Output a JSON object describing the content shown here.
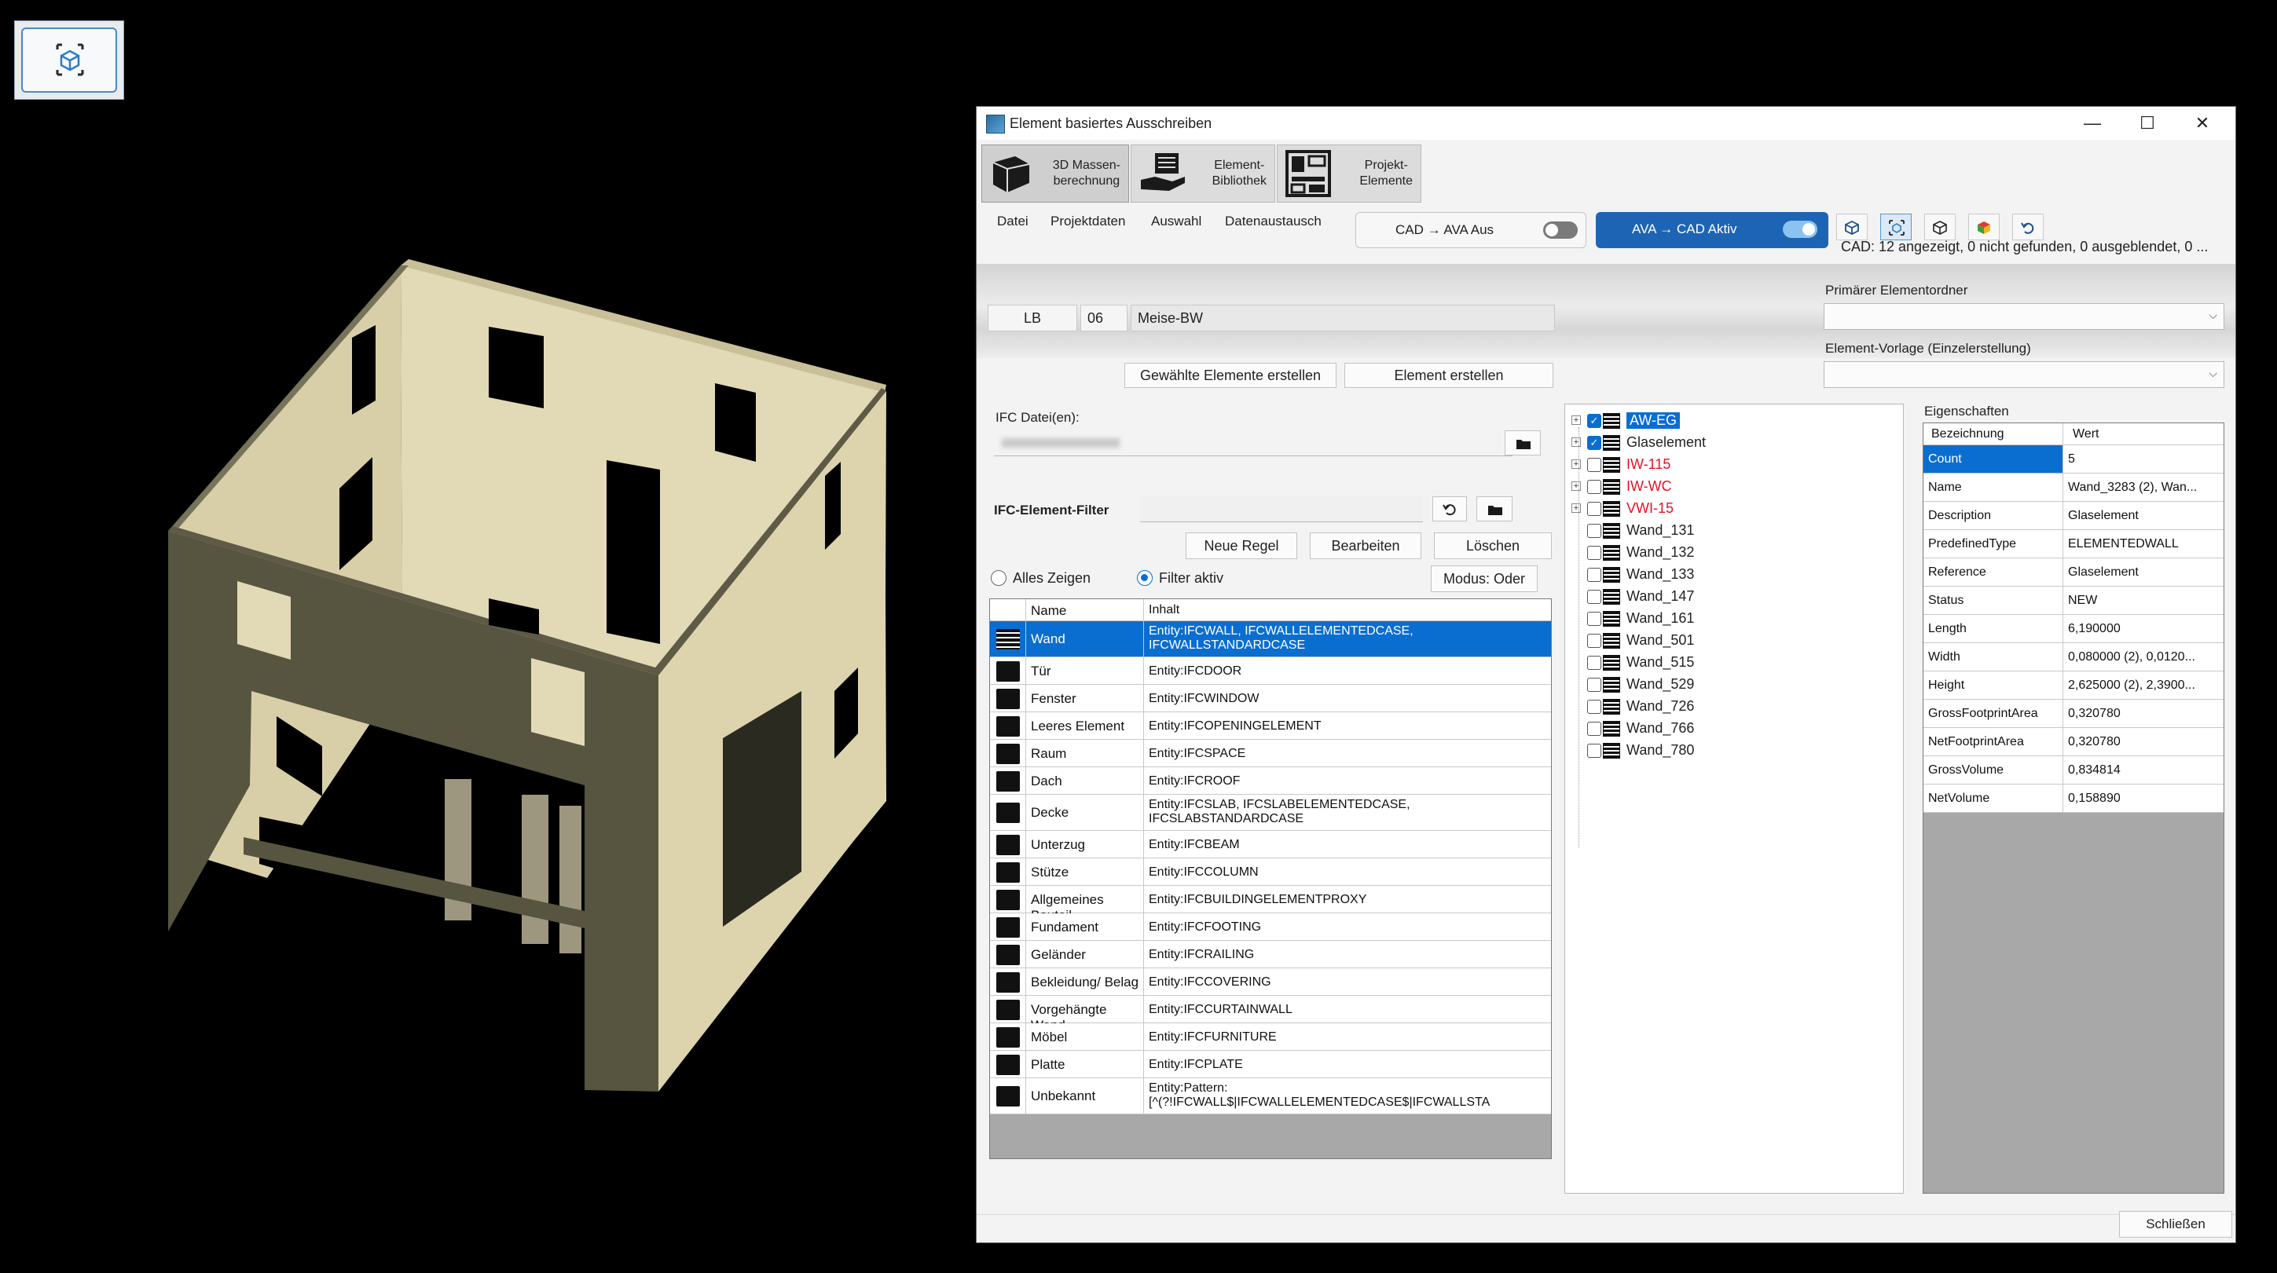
{
  "dialog": {
    "title": "Element basiertes Ausschreiben",
    "ribbon": [
      {
        "label": "3D Massen-\nberechnung"
      },
      {
        "label": "Element-\nBibliothek"
      },
      {
        "label": "Projekt-\nElemente"
      }
    ],
    "menu": [
      "Datei",
      "Projektdaten",
      "Auswahl",
      "Datenaustausch"
    ],
    "toggle_cad_ava": "CAD → AVA  Aus",
    "toggle_ava_cad": "AVA → CAD  Aktiv",
    "status": "CAD: 12 angezeigt, 0 nicht gefunden, 0 ausgeblendet, 0 ...",
    "lb_label": "LB",
    "lb_number": "06",
    "lb_name": "Meise-BW",
    "btn_create_selected": "Gewählte Elemente erstellen",
    "btn_create_element": "Element erstellen",
    "primary_folder_label": "Primärer Elementordner",
    "template_label": "Element-Vorlage (Einzelerstellung)",
    "ifc_files_label": "IFC Datei(en):",
    "ifc_filter_label": "IFC-Element-Filter",
    "btn_new_rule": "Neue Regel",
    "btn_edit": "Bearbeiten",
    "btn_delete": "Löschen",
    "radio_show_all": "Alles Zeigen",
    "radio_filter_active": "Filter aktiv",
    "btn_mode": "Modus: Oder",
    "filter_table": {
      "headers": [
        "Name",
        "Inhalt"
      ],
      "rows": [
        {
          "name": "Wand",
          "content": "Entity:IFCWALL, IFCWALLELEMENTEDCASE, IFCWALLSTANDARDCASE"
        },
        {
          "name": "Tür",
          "content": "Entity:IFCDOOR"
        },
        {
          "name": "Fenster",
          "content": "Entity:IFCWINDOW"
        },
        {
          "name": "Leeres Element",
          "content": "Entity:IFCOPENINGELEMENT"
        },
        {
          "name": "Raum",
          "content": "Entity:IFCSPACE"
        },
        {
          "name": "Dach",
          "content": "Entity:IFCROOF"
        },
        {
          "name": "Decke",
          "content": "Entity:IFCSLAB, IFCSLABELEMENTEDCASE, IFCSLABSTANDARDCASE"
        },
        {
          "name": "Unterzug",
          "content": "Entity:IFCBEAM"
        },
        {
          "name": "Stütze",
          "content": "Entity:IFCCOLUMN"
        },
        {
          "name": "Allgemeines Bauteil",
          "content": "Entity:IFCBUILDINGELEMENTPROXY"
        },
        {
          "name": "Fundament",
          "content": "Entity:IFCFOOTING"
        },
        {
          "name": "Geländer",
          "content": "Entity:IFCRAILING"
        },
        {
          "name": "Bekleidung/ Belag",
          "content": "Entity:IFCCOVERING"
        },
        {
          "name": "Vorgehängte Wand",
          "content": "Entity:IFCCURTAINWALL"
        },
        {
          "name": "Möbel",
          "content": "Entity:IFCFURNITURE"
        },
        {
          "name": "Platte",
          "content": "Entity:IFCPLATE"
        },
        {
          "name": "Unbekannt",
          "content": "Entity:Pattern: [^(?!IFCWALL$|IFCWALLELEMENTEDCASE$|IFCWALLSTA"
        }
      ]
    },
    "tree": [
      {
        "label": "AW-EG",
        "checked": true,
        "expander": true
      },
      {
        "label": "Glaselement",
        "checked": true,
        "expander": true
      },
      {
        "label": "IW-115",
        "checked": false,
        "expander": true
      },
      {
        "label": "IW-WC",
        "checked": false,
        "expander": true
      },
      {
        "label": "VWI-15",
        "checked": false,
        "expander": true
      },
      {
        "label": "Wand_131",
        "checked": false,
        "expander": false
      },
      {
        "label": "Wand_132",
        "checked": false,
        "expander": false
      },
      {
        "label": "Wand_133",
        "checked": false,
        "expander": false
      },
      {
        "label": "Wand_147",
        "checked": false,
        "expander": false
      },
      {
        "label": "Wand_161",
        "checked": false,
        "expander": false
      },
      {
        "label": "Wand_501",
        "checked": false,
        "expander": false
      },
      {
        "label": "Wand_515",
        "checked": false,
        "expander": false
      },
      {
        "label": "Wand_529",
        "checked": false,
        "expander": false
      },
      {
        "label": "Wand_726",
        "checked": false,
        "expander": false
      },
      {
        "label": "Wand_766",
        "checked": false,
        "expander": false
      },
      {
        "label": "Wand_780",
        "checked": false,
        "expander": false
      }
    ],
    "properties_label": "Eigenschaften",
    "properties": {
      "headers": [
        "Bezeichnung",
        "Wert"
      ],
      "rows": [
        {
          "key": "Count",
          "value": "5"
        },
        {
          "key": "Name",
          "value": "Wand_3283 (2), Wan..."
        },
        {
          "key": "Description",
          "value": "Glaselement"
        },
        {
          "key": "PredefinedType",
          "value": "ELEMENTEDWALL"
        },
        {
          "key": "Reference",
          "value": "Glaselement"
        },
        {
          "key": "Status",
          "value": "NEW"
        },
        {
          "key": "Length",
          "value": "6,190000"
        },
        {
          "key": "Width",
          "value": "0,080000 (2), 0,0120..."
        },
        {
          "key": "Height",
          "value": "2,625000 (2), 2,3900..."
        },
        {
          "key": "GrossFootprintArea",
          "value": "0,320780"
        },
        {
          "key": "NetFootprintArea",
          "value": "0,320780"
        },
        {
          "key": "GrossVolume",
          "value": "0,834814"
        },
        {
          "key": "NetVolume",
          "value": "0,158890"
        }
      ]
    },
    "btn_close": "Schließen"
  },
  "colors": {
    "accent": "#0a6ed1",
    "red_item": "#e81123",
    "wall_light": "#e4dcb8",
    "wall_dark": "#57543f"
  },
  "icons": [
    "3d-view-icon",
    "minimize-icon",
    "maximize-icon",
    "close-icon",
    "refresh-icon",
    "folder-icon",
    "cube-icon",
    "fit-view-icon",
    "color-cube-icon",
    "undo-icon"
  ]
}
